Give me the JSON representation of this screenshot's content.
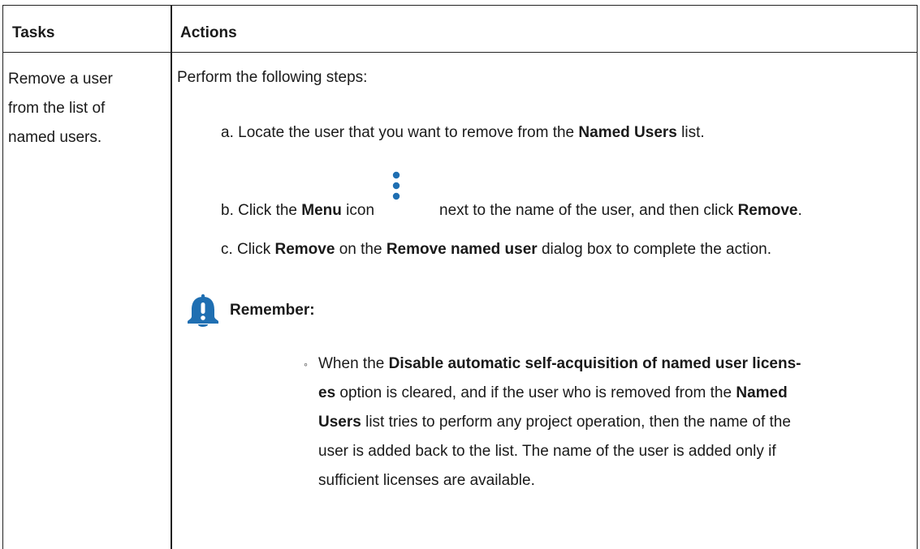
{
  "table": {
    "headers": {
      "tasks": "Tasks",
      "actions": "Actions"
    },
    "row": {
      "task_lines": [
        "Remove a user",
        "from the list of",
        "named users."
      ],
      "intro": "Perform the following steps:",
      "steps": {
        "a": {
          "prefix": "a. Locate the user that you want to remove from the ",
          "bold1": "Named Users",
          "suffix": " list."
        },
        "b": {
          "prefix": "b. Click the ",
          "bold1": "Menu",
          "mid1": " icon",
          "icon": "vertical-ellipsis-menu-icon",
          "mid2": "next to the name of the user, and then click ",
          "bold2": "Remove",
          "suffix": "."
        },
        "c": {
          "prefix": "c. Click ",
          "bold1": "Remove",
          "mid1": " on the ",
          "bold2": "Remove named user",
          "suffix": " dialog box to complete the action."
        }
      },
      "note": {
        "icon": "bell-alert-icon",
        "label": "Remember:",
        "bullet_marker": "◦",
        "lines": {
          "l1_prefix": "When the ",
          "l1_bold": "Disable automatic self-acquisition of named user licens-",
          "l2_bold": "es",
          "l2_mid": " option is cleared, and if the user who is removed from the ",
          "l2_bold2": "Named",
          "l3_bold": "Users",
          "l3_rest": " list tries to perform any project operation, then the name of the",
          "l4": "user is added back to the list. The name of the user is added only if",
          "l5": "sufficient licenses are available."
        }
      }
    }
  },
  "colors": {
    "icon_blue": "#1f6fb2",
    "bell_blue": "#1f6fb2",
    "border": "#222222"
  }
}
